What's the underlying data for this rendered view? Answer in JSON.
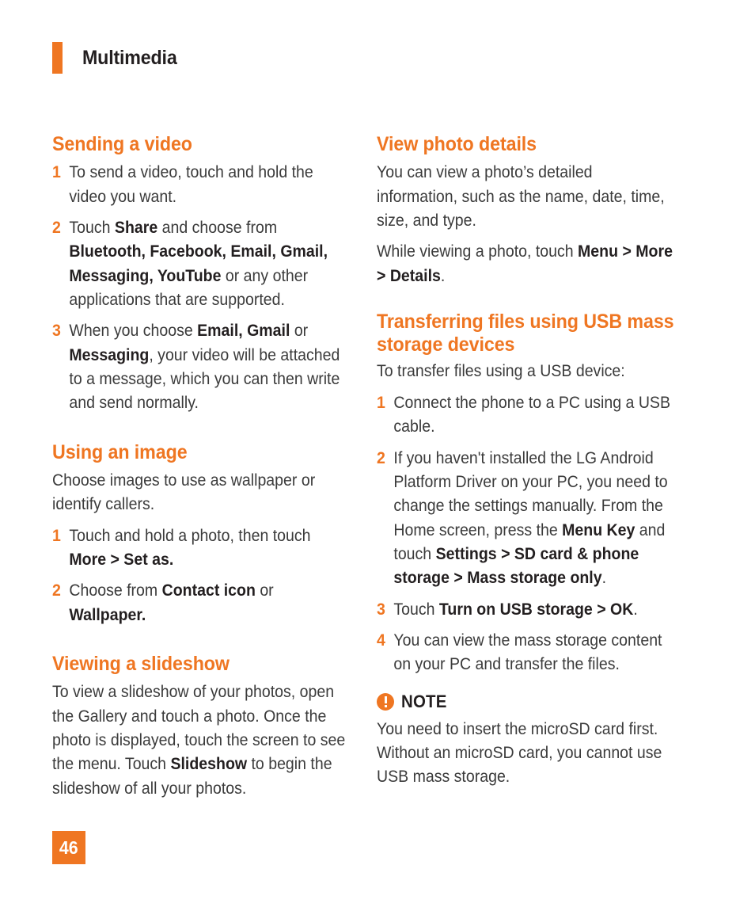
{
  "colors": {
    "accent": "#ef7622",
    "heading": "#ef7622",
    "body": "#3b3b3b",
    "bold": "#231f20",
    "page_bg": "#ffffff"
  },
  "header": {
    "title": "Multimedia"
  },
  "footer": {
    "page_number": "46"
  },
  "left_column": {
    "section1": {
      "heading": "Sending a video",
      "steps": [
        {
          "num": "1",
          "parts": [
            {
              "text": "To send a video, touch and hold the video you want.",
              "bold": false
            }
          ]
        },
        {
          "num": "2",
          "parts": [
            {
              "text": "Touch ",
              "bold": false
            },
            {
              "text": "Share",
              "bold": true
            },
            {
              "text": " and choose from ",
              "bold": false
            },
            {
              "text": "Bluetooth, Facebook, Email, Gmail, Messaging, YouTube",
              "bold": true
            },
            {
              "text": " or any other applications that are supported.",
              "bold": false
            }
          ]
        },
        {
          "num": "3",
          "parts": [
            {
              "text": "When you choose ",
              "bold": false
            },
            {
              "text": "Email, Gmail",
              "bold": true
            },
            {
              "text": " or ",
              "bold": false
            },
            {
              "text": "Messaging",
              "bold": true
            },
            {
              "text": ", your video will be attached to a message, which you can then write and send normally.",
              "bold": false
            }
          ]
        }
      ]
    },
    "section2": {
      "heading": "Using an image",
      "intro": [
        {
          "text": "Choose images to use as wallpaper or identify callers.",
          "bold": false
        }
      ],
      "steps": [
        {
          "num": "1",
          "parts": [
            {
              "text": "Touch and hold a photo, then touch ",
              "bold": false
            },
            {
              "text": "More > Set as.",
              "bold": true
            }
          ]
        },
        {
          "num": "2",
          "parts": [
            {
              "text": "Choose from ",
              "bold": false
            },
            {
              "text": "Contact icon",
              "bold": true
            },
            {
              "text": " or ",
              "bold": false
            },
            {
              "text": "Wallpaper.",
              "bold": true
            }
          ]
        }
      ]
    },
    "section3": {
      "heading": "Viewing a slideshow",
      "body": [
        {
          "text": "To view a slideshow of your photos, open the Gallery and touch a photo. Once the photo is displayed, touch the screen to see the menu. Touch ",
          "bold": false
        },
        {
          "text": "Slideshow",
          "bold": true
        },
        {
          "text": " to begin the slideshow of all your photos.",
          "bold": false
        }
      ]
    }
  },
  "right_column": {
    "section1": {
      "heading": "View photo details",
      "para1": [
        {
          "text": "You can view a photo’s detailed information, such as the name, date, time, size, and type.",
          "bold": false
        }
      ],
      "para2": [
        {
          "text": "While viewing a photo, touch ",
          "bold": false
        },
        {
          "text": "Menu > More > Details",
          "bold": true
        },
        {
          "text": ".",
          "bold": false
        }
      ]
    },
    "section2": {
      "heading": "Transferring files using USB mass storage devices",
      "intro": [
        {
          "text": "To transfer files using a USB device:",
          "bold": false
        }
      ],
      "steps": [
        {
          "num": "1",
          "parts": [
            {
              "text": "Connect the phone to a PC using a USB cable.",
              "bold": false
            }
          ]
        },
        {
          "num": "2",
          "parts": [
            {
              "text": "If you haven't installed the LG Android Platform Driver on your PC, you need to change the settings manually. From the Home screen, press the ",
              "bold": false
            },
            {
              "text": "Menu Key",
              "bold": true
            },
            {
              "text": " and touch ",
              "bold": false
            },
            {
              "text": "Settings > SD card & phone storage > Mass storage only",
              "bold": true
            },
            {
              "text": ".",
              "bold": false
            }
          ]
        },
        {
          "num": "3",
          "parts": [
            {
              "text": "Touch ",
              "bold": false
            },
            {
              "text": "Turn on USB storage > OK",
              "bold": true
            },
            {
              "text": ".",
              "bold": false
            }
          ]
        },
        {
          "num": "4",
          "parts": [
            {
              "text": "You can view the mass storage content on your PC and transfer the files.",
              "bold": false
            }
          ]
        }
      ],
      "note": {
        "icon": "exclamation-circle-icon",
        "label": "NOTE",
        "body": [
          {
            "text": "You need to insert the microSD card first. Without an microSD card, you cannot use USB mass storage.",
            "bold": false
          }
        ]
      }
    }
  }
}
